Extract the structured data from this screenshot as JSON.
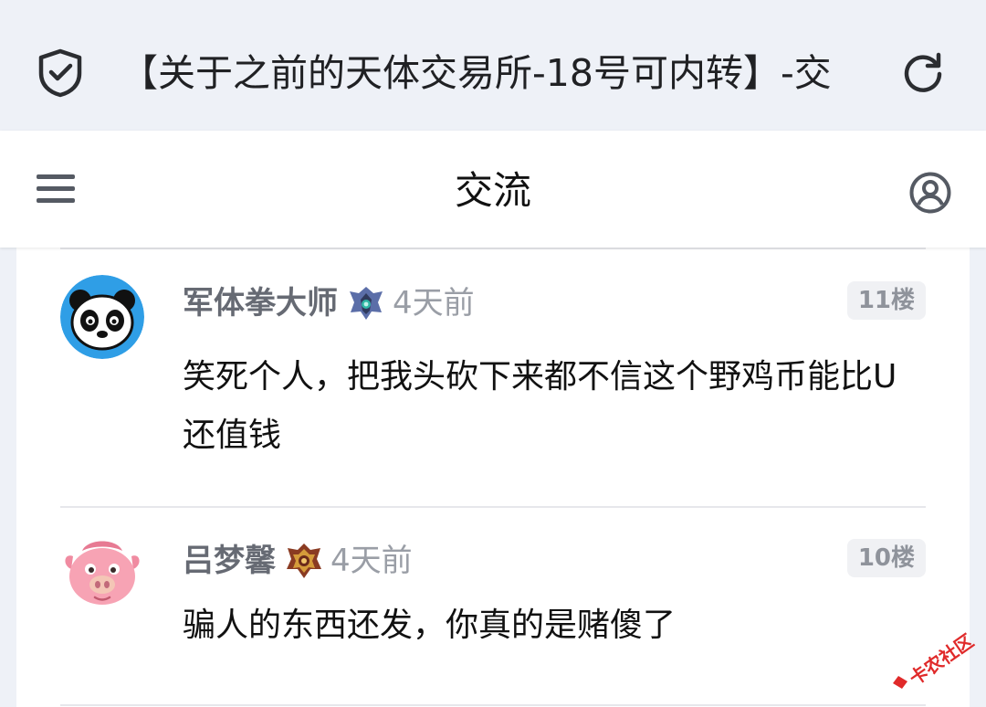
{
  "browser": {
    "page_title": "【关于之前的天体交易所-18号可内转】-交",
    "shield_icon": "shield-check-icon",
    "reload_icon": "reload-icon"
  },
  "header": {
    "title": "交流",
    "menu_icon": "hamburger-menu-icon",
    "user_icon": "user-circle-icon"
  },
  "posts": [
    {
      "author": "军体拳大师",
      "time": "4天前",
      "floor": "11楼",
      "content": "笑死个人，把我头砍下来都不信这个野鸡币能比U还值钱",
      "avatar": "panda-avatar",
      "badge": "blue-rank-badge"
    },
    {
      "author": "吕梦馨",
      "time": "4天前",
      "floor": "10楼",
      "content": "骗人的东西还发，你真的是赌傻了",
      "avatar": "pink-pig-avatar",
      "badge": "gold-rank-badge"
    }
  ],
  "watermark": {
    "text": "卡农社区"
  },
  "colors": {
    "page_bg": "#eef1f7",
    "card_bg": "#ffffff",
    "author": "#666a73",
    "time": "#9a9ea6",
    "floor_bg": "#f0f1f4",
    "watermark": "#e02a2a"
  }
}
